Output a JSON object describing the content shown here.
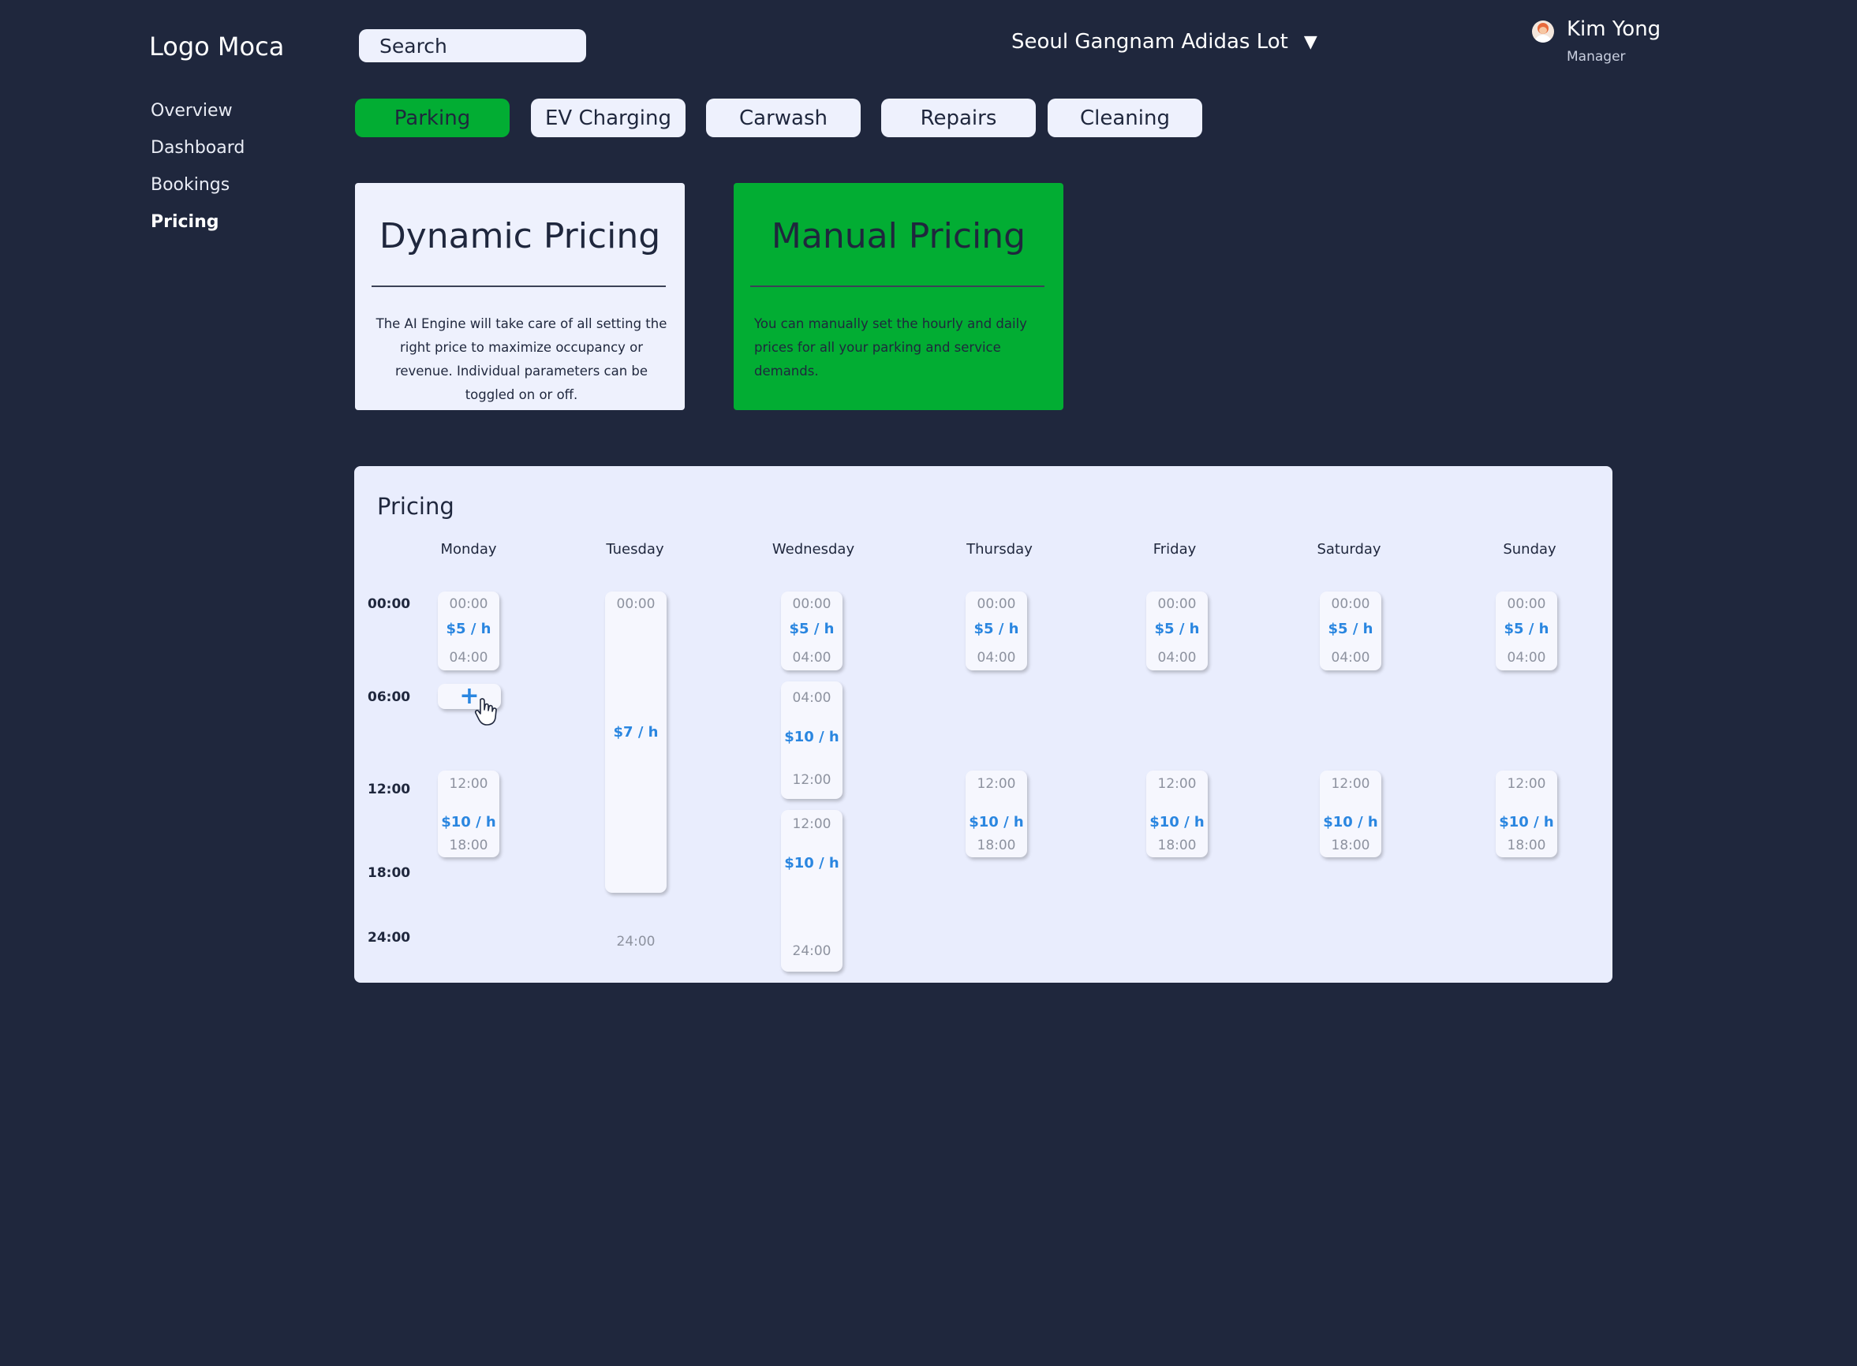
{
  "app": {
    "logo": "Logo Moca",
    "search_placeholder": "Search"
  },
  "location": {
    "selected": "Seoul Gangnam Adidas Lot",
    "caret": "▼"
  },
  "user": {
    "name": "Kim Yong",
    "role": "Manager"
  },
  "sidebar": {
    "items": [
      {
        "label": "Overview"
      },
      {
        "label": "Dashboard"
      },
      {
        "label": "Bookings"
      },
      {
        "label": "Pricing",
        "active": true
      }
    ]
  },
  "service_tabs": [
    {
      "label": "Parking",
      "active": true
    },
    {
      "label": "EV Charging"
    },
    {
      "label": "Carwash"
    },
    {
      "label": "Repairs"
    },
    {
      "label": "Cleaning"
    }
  ],
  "pricing_modes": {
    "dynamic": {
      "title": "Dynamic Pricing",
      "description": "The AI Engine will take care of all setting the right price to maximize occupancy or revenue. Individual parameters can be toggled on or off."
    },
    "manual": {
      "title": "Manual Pricing",
      "description": "You can manually set the hourly and daily prices for all your parking and service demands.",
      "selected": true
    }
  },
  "schedule": {
    "title": "Pricing",
    "days": [
      "Monday",
      "Tuesday",
      "Wednesday",
      "Thursday",
      "Friday",
      "Saturday",
      "Sunday"
    ],
    "time_labels": [
      "00:00",
      "06:00",
      "12:00",
      "18:00",
      "24:00"
    ],
    "add_icon": "plus-icon",
    "slots": {
      "monday": [
        {
          "start": "00:00",
          "price": "$5 / h",
          "end": "04:00"
        },
        {
          "start": "12:00",
          "price": "$10 / h",
          "end": "18:00"
        }
      ],
      "tuesday": [
        {
          "start": "00:00",
          "price": "$7 / h",
          "end": "24:00"
        }
      ],
      "wednesday": [
        {
          "start": "00:00",
          "price": "$5 / h",
          "end": "04:00"
        },
        {
          "start": "04:00",
          "price": "$10 / h",
          "end": "12:00"
        },
        {
          "start": "12:00",
          "price": "$10 / h",
          "end": "24:00"
        }
      ],
      "thursday": [
        {
          "start": "00:00",
          "price": "$5 / h",
          "end": "04:00"
        },
        {
          "start": "12:00",
          "price": "$10 / h",
          "end": "18:00"
        }
      ],
      "friday": [
        {
          "start": "00:00",
          "price": "$5 / h",
          "end": "04:00"
        },
        {
          "start": "12:00",
          "price": "$10 / h",
          "end": "18:00"
        }
      ],
      "saturday": [
        {
          "start": "00:00",
          "price": "$5 / h",
          "end": "04:00"
        },
        {
          "start": "12:00",
          "price": "$10 / h",
          "end": "18:00"
        }
      ],
      "sunday": [
        {
          "start": "00:00",
          "price": "$5 / h",
          "end": "04:00"
        },
        {
          "start": "12:00",
          "price": "$10 / h",
          "end": "18:00"
        }
      ]
    }
  },
  "colors": {
    "background": "#1f273d",
    "accent_green": "#02ad33",
    "card_light": "#eef1fd",
    "price_blue": "#2a86e0",
    "time_gray": "#8d929f"
  }
}
